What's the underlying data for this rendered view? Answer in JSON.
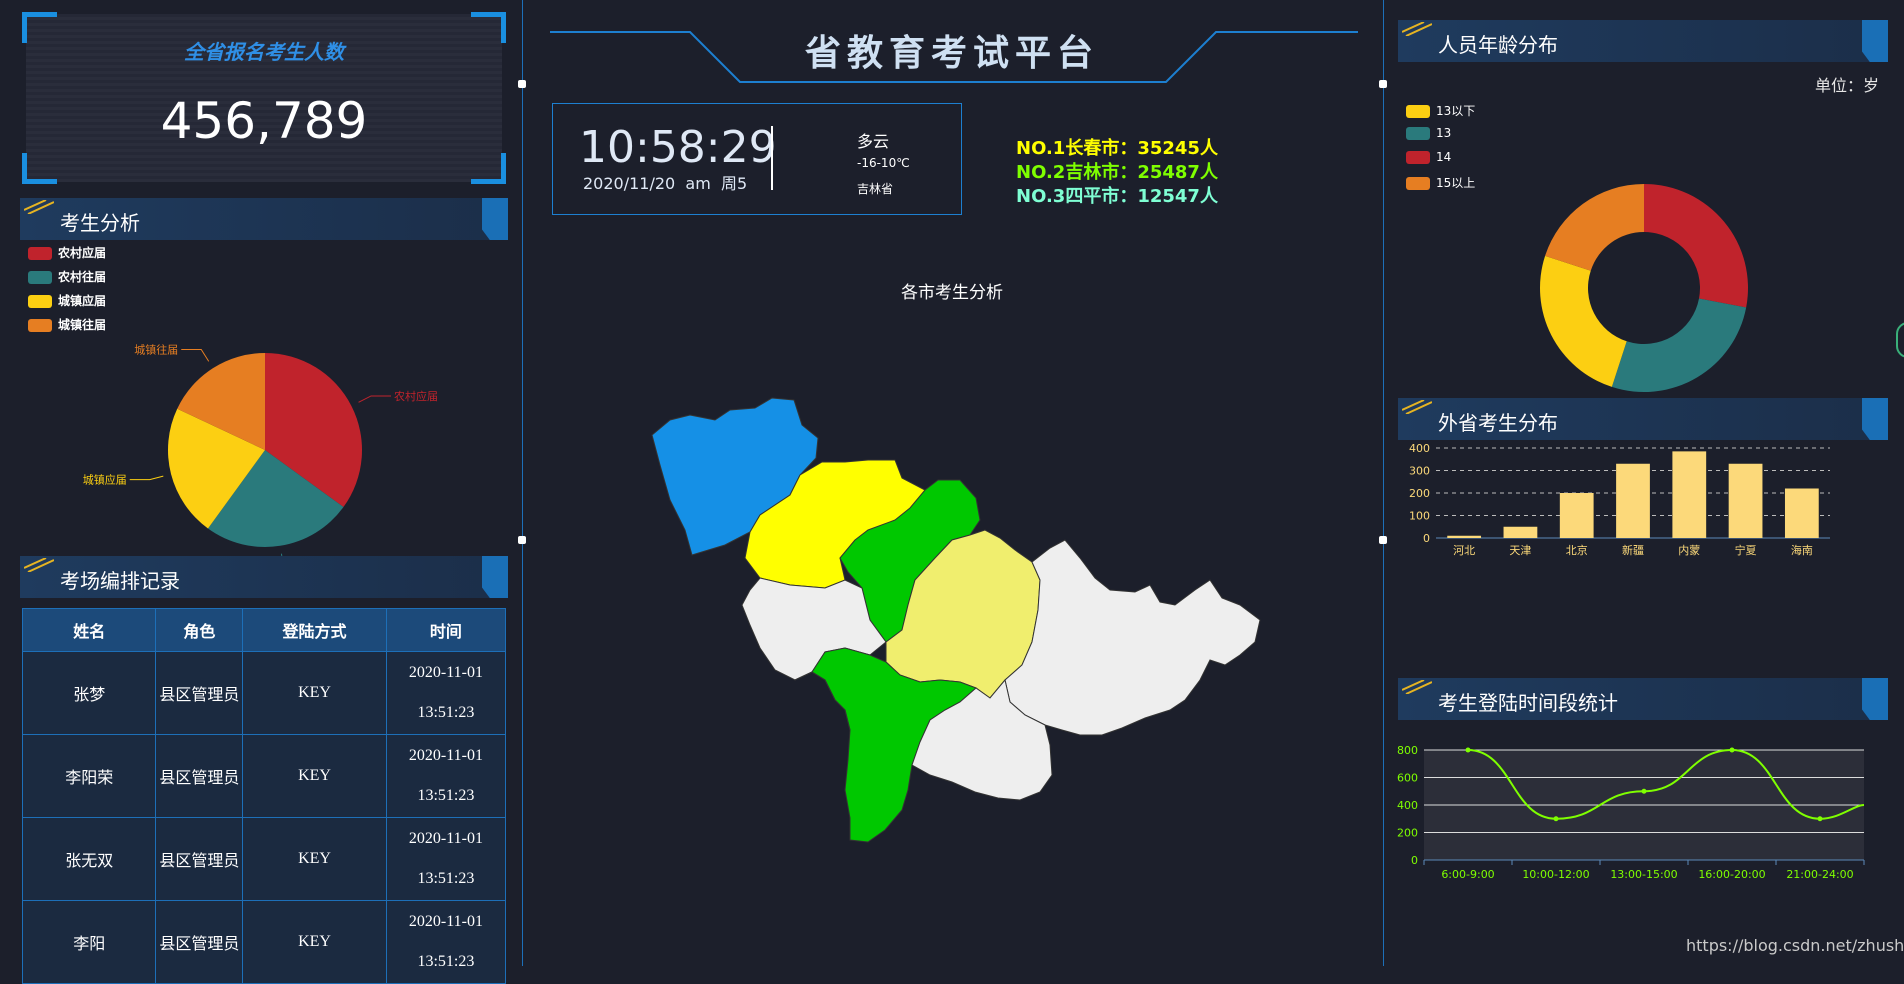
{
  "total": {
    "title": "全省报名考生人数",
    "value": "456,789"
  },
  "candidate_analysis": {
    "title": "考生分析",
    "legend": [
      {
        "label": "农村应届",
        "color": "#c0232c"
      },
      {
        "label": "农村往届",
        "color": "#2a7a7c"
      },
      {
        "label": "城镇应届",
        "color": "#fccf12"
      },
      {
        "label": "城镇往届",
        "color": "#e67e22"
      }
    ]
  },
  "exam_records": {
    "title": "考场编排记录",
    "headers": [
      "姓名",
      "角色",
      "登陆方式",
      "时间"
    ],
    "rows": [
      {
        "name": "张梦",
        "role": "县区管理员",
        "method": "KEY",
        "date": "2020-11-01",
        "clock": "13:51:23"
      },
      {
        "name": "李阳荣",
        "role": "县区管理员",
        "method": "KEY",
        "date": "2020-11-01",
        "clock": "13:51:23"
      },
      {
        "name": "张无双",
        "role": "县区管理员",
        "method": "KEY",
        "date": "2020-11-01",
        "clock": "13:51:23"
      },
      {
        "name": "李阳",
        "role": "县区管理员",
        "method": "KEY",
        "date": "2020-11-01",
        "clock": "13:51:23"
      }
    ]
  },
  "header": {
    "title": "省教育考试平台"
  },
  "clock": {
    "time": "10:58:29",
    "date": "2020/11/20  am  周5"
  },
  "weather": {
    "condition": "多云",
    "temp": "-16-10℃",
    "location": "吉林省"
  },
  "rankings": [
    {
      "text": "NO.1长春市：35245人",
      "color": "#ffff00"
    },
    {
      "text": "NO.2吉林市：25487人",
      "color": "#7fff00"
    },
    {
      "text": "NO.3四平市：12547人",
      "color": "#7fffd4"
    }
  ],
  "map": {
    "title": "各市考生分析"
  },
  "age": {
    "title": "人员年龄分布",
    "unit": "单位：岁",
    "legend": [
      {
        "label": "13以下",
        "color": "#fccf12"
      },
      {
        "label": "13",
        "color": "#2a7a7c"
      },
      {
        "label": "14",
        "color": "#c0232c"
      },
      {
        "label": "15以上",
        "color": "#e67e22"
      }
    ]
  },
  "other_province": {
    "title": "外省考生分布"
  },
  "login_time": {
    "title": "考生登陆时间段统计"
  },
  "watermark": "https://blog.csdn.net/zhushijei",
  "chart_data": [
    {
      "type": "pie",
      "labels": [
        "农村应届",
        "农村往届",
        "城镇应届",
        "城镇往届"
      ],
      "values": [
        35,
        25,
        22,
        18
      ],
      "colors": [
        "#c0232c",
        "#2a7a7c",
        "#fccf12",
        "#e67e22"
      ]
    },
    {
      "type": "pie",
      "labels": [
        "14",
        "13",
        "13以下",
        "15以上"
      ],
      "values": [
        28,
        27,
        25,
        20
      ],
      "colors": [
        "#c0232c",
        "#2a7a7c",
        "#fccf12",
        "#e67e22"
      ]
    },
    {
      "type": "bar",
      "categories": [
        "河北",
        "天津",
        "北京",
        "新疆",
        "内蒙",
        "宁夏",
        "海南"
      ],
      "values": [
        10,
        50,
        200,
        330,
        385,
        330,
        220
      ],
      "ylim": [
        0,
        400
      ],
      "yticks": [
        0,
        100,
        200,
        300,
        400
      ],
      "color": "#fcd97a"
    },
    {
      "type": "line",
      "categories": [
        "6:00-9:00",
        "10:00-12:00",
        "13:00-15:00",
        "16:00-20:00",
        "21:00-24:00"
      ],
      "values": [
        800,
        300,
        500,
        800,
        300
      ],
      "ylim": [
        0,
        800
      ],
      "yticks": [
        0,
        200,
        400,
        600,
        800
      ],
      "color": "#7fff00"
    }
  ]
}
